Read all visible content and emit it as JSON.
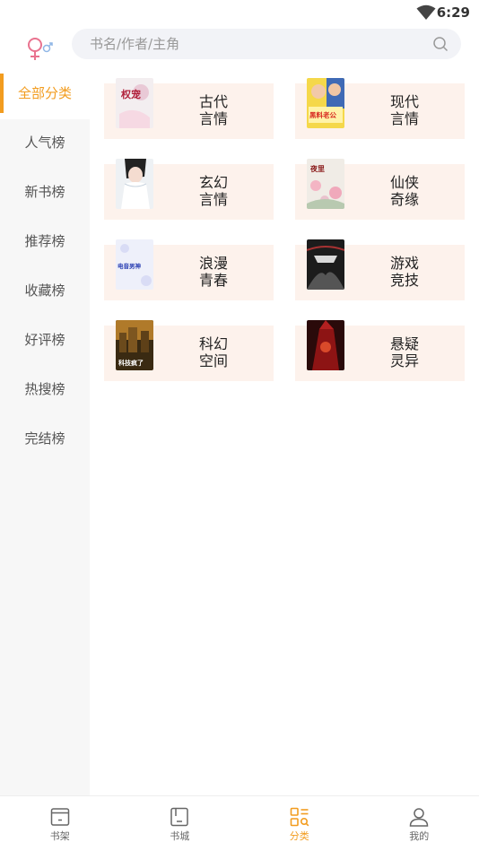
{
  "status_bar": {
    "time": "6:29"
  },
  "search": {
    "placeholder": "书名/作者/主角"
  },
  "sidebar": {
    "items": [
      {
        "label": "全部分类",
        "active": true
      },
      {
        "label": "人气榜"
      },
      {
        "label": "新书榜"
      },
      {
        "label": "推荐榜"
      },
      {
        "label": "收藏榜"
      },
      {
        "label": "好评榜"
      },
      {
        "label": "热搜榜"
      },
      {
        "label": "完结榜"
      }
    ]
  },
  "categories": [
    {
      "line1": "古代",
      "line2": "言情",
      "cover_text": "权宠"
    },
    {
      "line1": "现代",
      "line2": "言情",
      "cover_text": "黑料老公"
    },
    {
      "line1": "玄幻",
      "line2": "言情",
      "cover_text": ""
    },
    {
      "line1": "仙侠",
      "line2": "奇缘",
      "cover_text": "夜里"
    },
    {
      "line1": "浪漫",
      "line2": "青春",
      "cover_text": "电音男神"
    },
    {
      "line1": "游戏",
      "line2": "竞技",
      "cover_text": ""
    },
    {
      "line1": "科幻",
      "line2": "空间",
      "cover_text": "科技疯了"
    },
    {
      "line1": "悬疑",
      "line2": "灵异",
      "cover_text": ""
    }
  ],
  "bottom_nav": {
    "items": [
      {
        "label": "书架"
      },
      {
        "label": "书城"
      },
      {
        "label": "分类",
        "active": true
      },
      {
        "label": "我的"
      }
    ]
  },
  "colors": {
    "accent": "#f29c1f",
    "card_bg": "#fdf2ec",
    "sidebar_bg": "#f7f7f7"
  }
}
